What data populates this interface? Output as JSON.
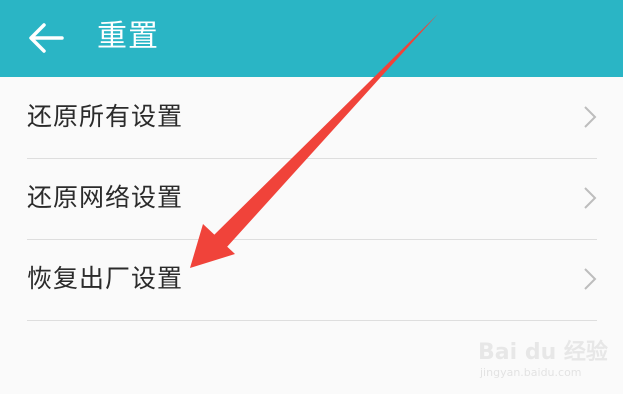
{
  "header": {
    "title": "重置",
    "back_icon": "arrow-left-icon",
    "background_color": "#2ab5c5"
  },
  "list": {
    "items": [
      {
        "label": "还原所有设置",
        "icon": "chevron-right-icon"
      },
      {
        "label": "还原网络设置",
        "icon": "chevron-right-icon"
      },
      {
        "label": "恢复出厂设置",
        "icon": "chevron-right-icon"
      }
    ]
  },
  "annotation": {
    "arrow_color": "#f0433a"
  },
  "watermark": {
    "brand": "Bai du 经验",
    "url": "jingyan.baidu.com"
  }
}
